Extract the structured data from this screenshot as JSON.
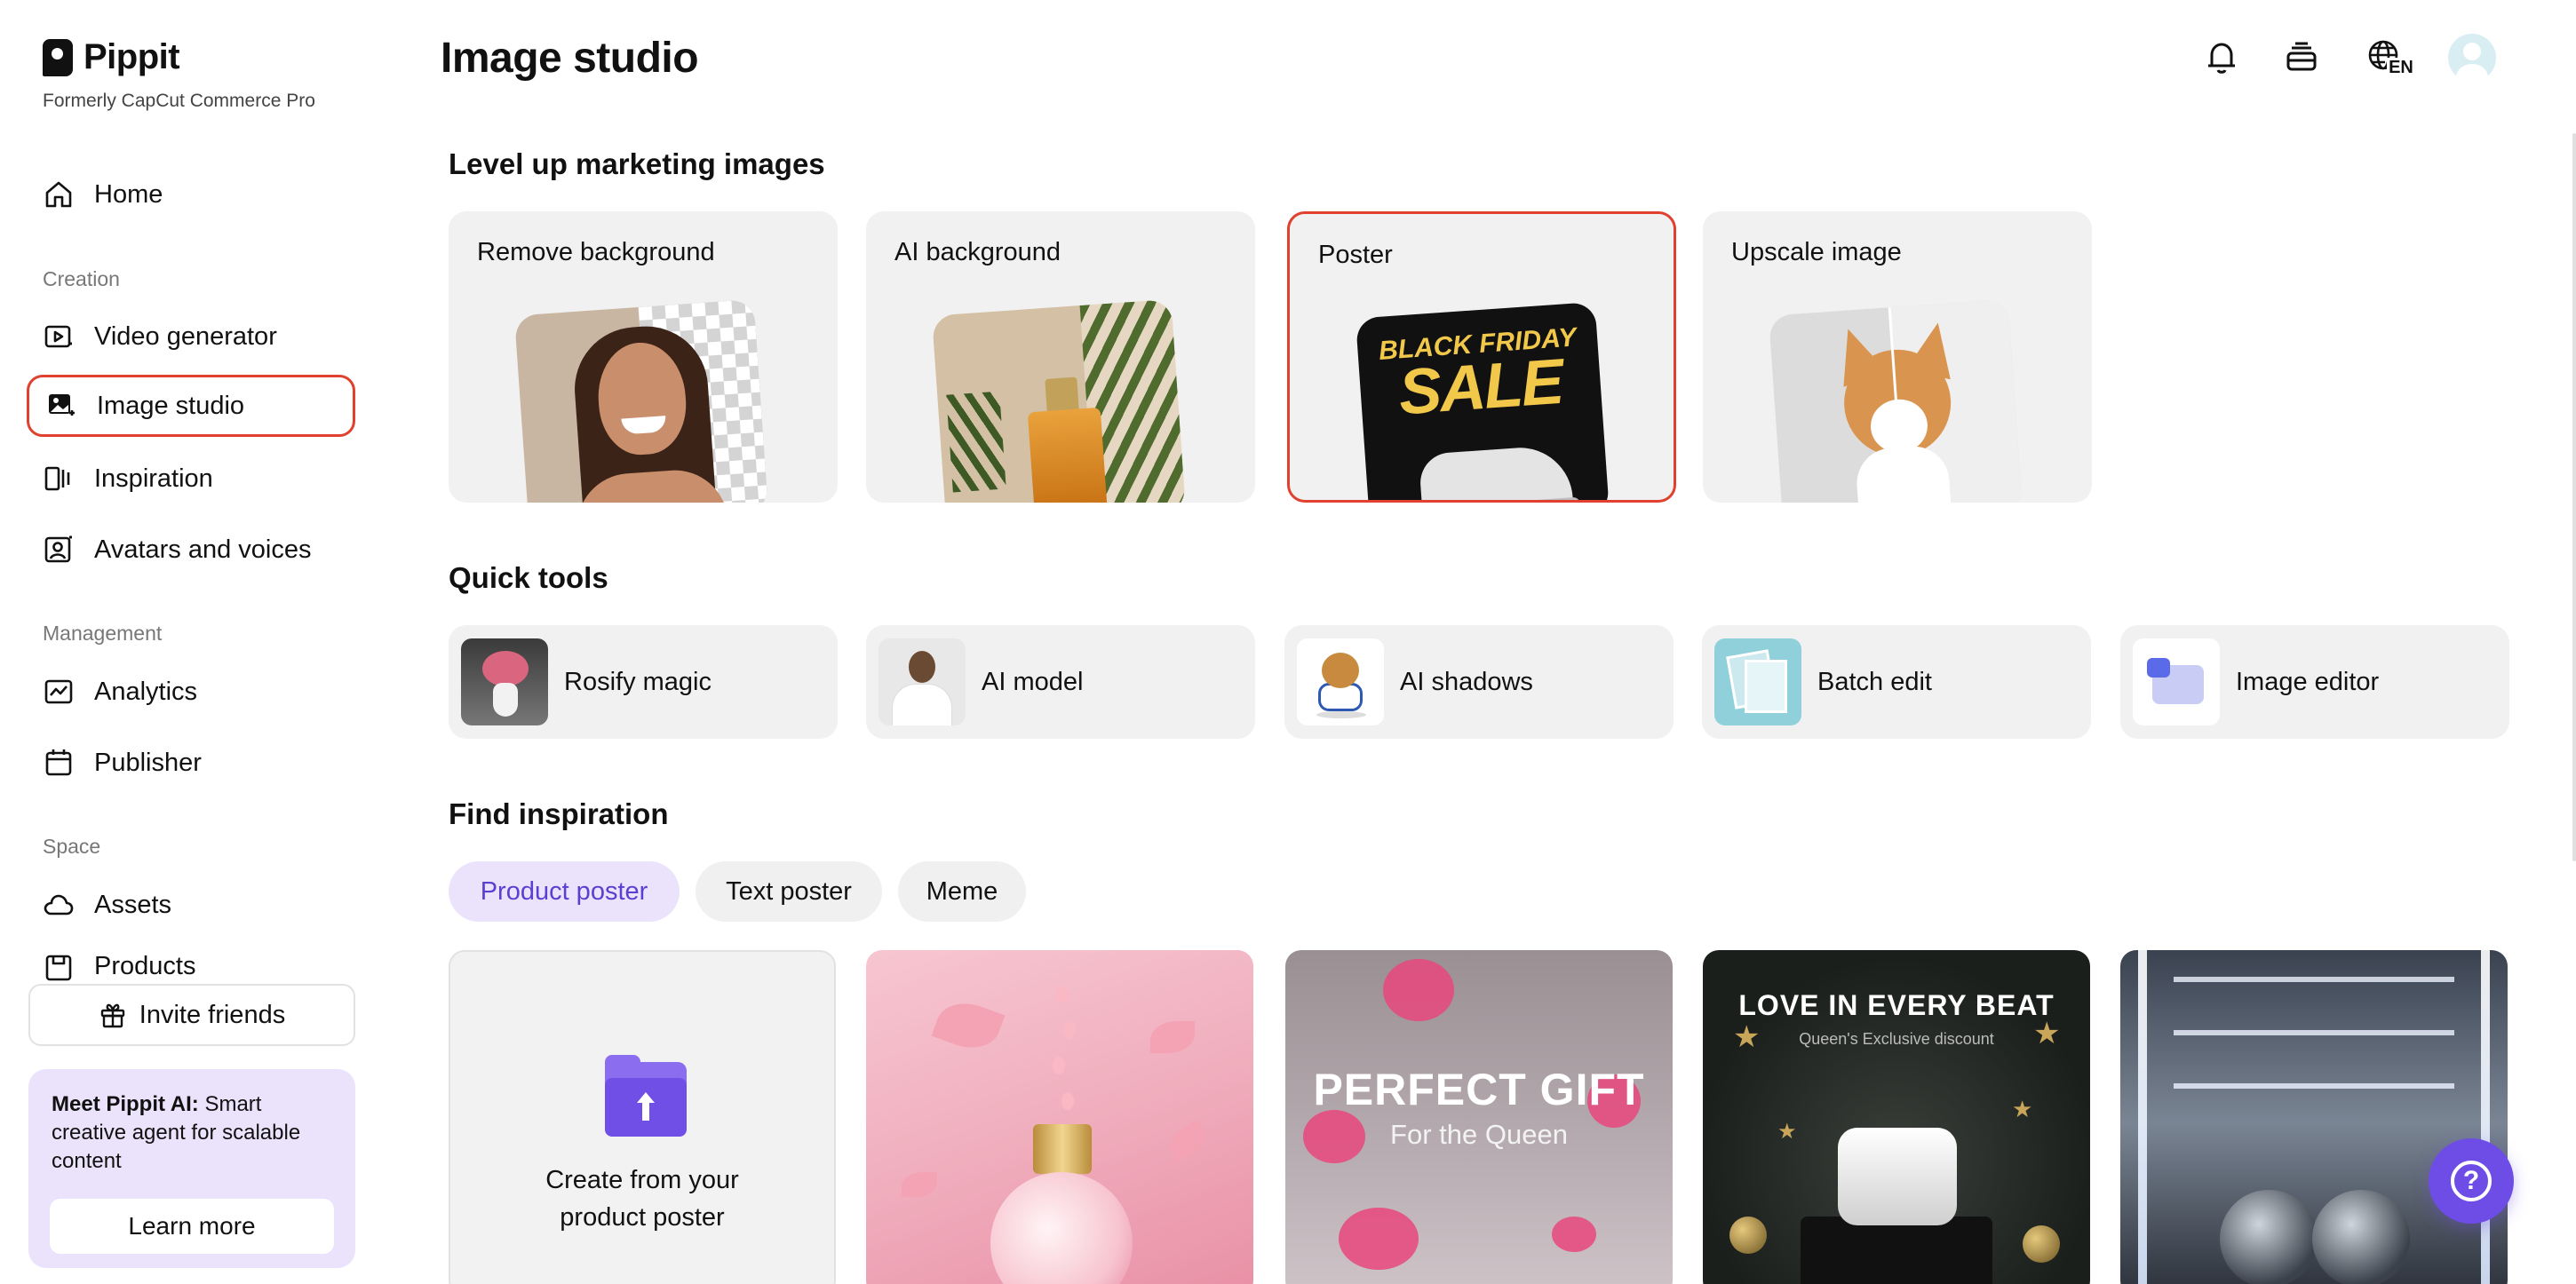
{
  "brand": {
    "name": "Pippit",
    "subtitle": "Formerly CapCut Commerce Pro"
  },
  "sidebar": {
    "home": "Home",
    "sections": {
      "creation": "Creation",
      "management": "Management",
      "space": "Space"
    },
    "items": {
      "video_generator": "Video generator",
      "image_studio": "Image studio",
      "inspiration": "Inspiration",
      "avatars": "Avatars and voices",
      "analytics": "Analytics",
      "publisher": "Publisher",
      "assets": "Assets",
      "products": "Products"
    },
    "active_item": "Image studio",
    "invite": "Invite friends",
    "promo": {
      "title": "Meet Pippit AI:",
      "body": " Smart creative agent for scalable content",
      "button": "Learn more"
    }
  },
  "header": {
    "title": "Image studio",
    "language": "EN"
  },
  "marketing": {
    "title": "Level up marketing images",
    "cards": [
      {
        "label": "Remove background"
      },
      {
        "label": "AI background"
      },
      {
        "label": "Poster"
      },
      {
        "label": "Upscale image"
      }
    ],
    "selected": "Poster",
    "poster_art": {
      "line1": "BLACK FRIDAY",
      "line2": "SALE"
    }
  },
  "quick_tools": {
    "title": "Quick tools",
    "items": [
      {
        "label": "Rosify magic"
      },
      {
        "label": "AI model"
      },
      {
        "label": "AI shadows"
      },
      {
        "label": "Batch edit"
      },
      {
        "label": "Image editor"
      }
    ]
  },
  "inspiration": {
    "title": "Find inspiration",
    "tabs": [
      {
        "label": "Product poster"
      },
      {
        "label": "Text poster"
      },
      {
        "label": "Meme"
      }
    ],
    "active_tab": "Product poster",
    "create_card": {
      "line1": "Create from your",
      "line2": "product poster"
    },
    "gift_card": {
      "title": "PERFECT GIFT",
      "subtitle": "For the Queen"
    },
    "beat_card": {
      "title": "LOVE IN EVERY BEAT",
      "subtitle": "Queen's Exclusive discount"
    }
  },
  "colors": {
    "highlight": "#e0402e",
    "accent": "#6d4de6",
    "active_tab_bg": "#ebe3fb",
    "card_bg": "#f1f1f1"
  }
}
